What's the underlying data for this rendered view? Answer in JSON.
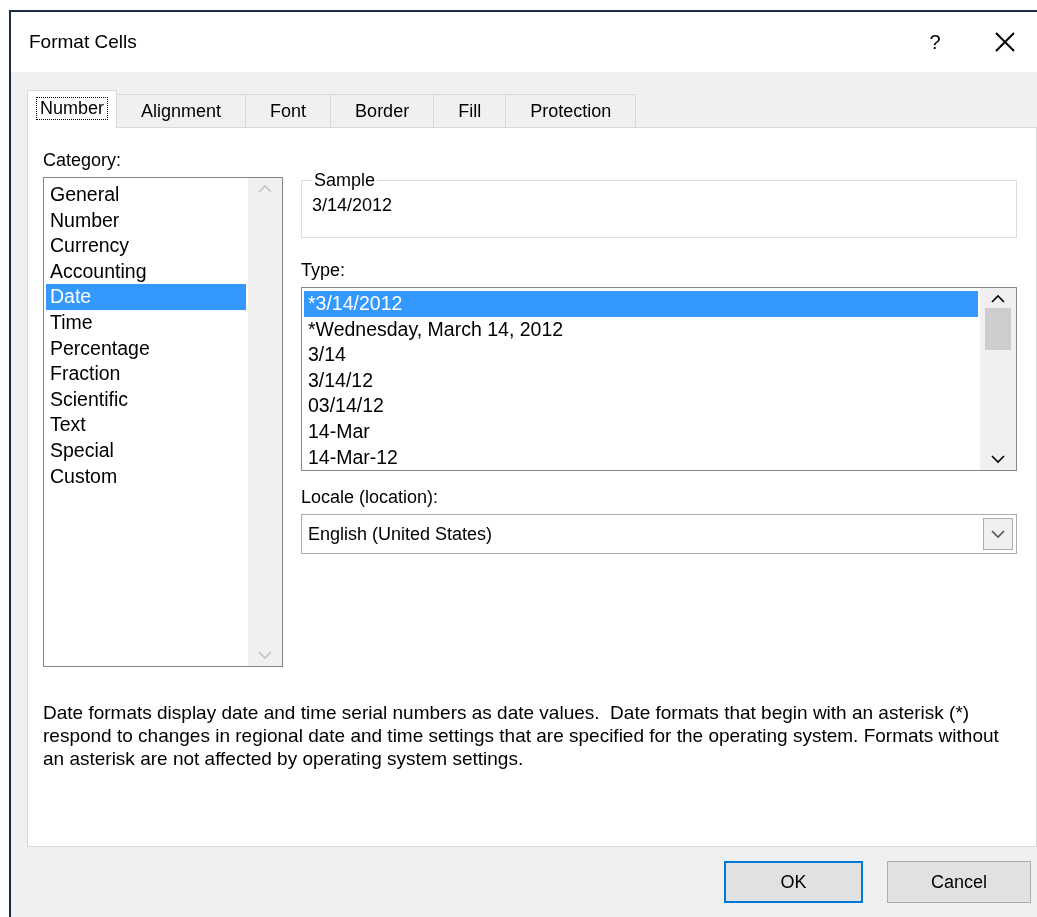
{
  "window": {
    "title": "Format Cells",
    "help": "?"
  },
  "tabs": [
    {
      "label": "Number",
      "selected": true
    },
    {
      "label": "Alignment",
      "selected": false
    },
    {
      "label": "Font",
      "selected": false
    },
    {
      "label": "Border",
      "selected": false
    },
    {
      "label": "Fill",
      "selected": false
    },
    {
      "label": "Protection",
      "selected": false
    }
  ],
  "category": {
    "label": "Category:",
    "items": [
      {
        "label": "General",
        "selected": false
      },
      {
        "label": "Number",
        "selected": false
      },
      {
        "label": "Currency",
        "selected": false
      },
      {
        "label": "Accounting",
        "selected": false
      },
      {
        "label": "Date",
        "selected": true
      },
      {
        "label": "Time",
        "selected": false
      },
      {
        "label": "Percentage",
        "selected": false
      },
      {
        "label": "Fraction",
        "selected": false
      },
      {
        "label": "Scientific",
        "selected": false
      },
      {
        "label": "Text",
        "selected": false
      },
      {
        "label": "Special",
        "selected": false
      },
      {
        "label": "Custom",
        "selected": false
      }
    ]
  },
  "sample": {
    "label": "Sample",
    "value": "3/14/2012"
  },
  "type": {
    "label": "Type:",
    "items": [
      {
        "label": "*3/14/2012",
        "selected": true
      },
      {
        "label": "*Wednesday, March 14, 2012",
        "selected": false
      },
      {
        "label": "3/14",
        "selected": false
      },
      {
        "label": "3/14/12",
        "selected": false
      },
      {
        "label": "03/14/12",
        "selected": false
      },
      {
        "label": "14-Mar",
        "selected": false
      },
      {
        "label": "14-Mar-12",
        "selected": false
      }
    ]
  },
  "locale": {
    "label": "Locale (location):",
    "value": "English (United States)"
  },
  "description": "Date formats display date and time serial numbers as date values.  Date formats that begin with an asterisk (*) respond to changes in regional date and time settings that are specified for the operating system. Formats without an asterisk are not affected by operating system settings.",
  "buttons": [
    {
      "label": "OK",
      "default": true
    },
    {
      "label": "Cancel",
      "default": false
    }
  ]
}
